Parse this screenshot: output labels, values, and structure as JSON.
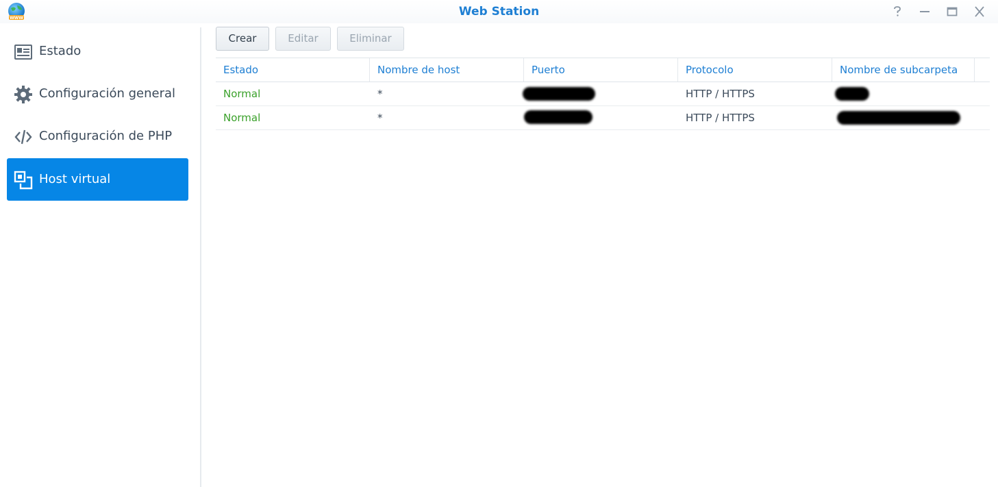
{
  "window": {
    "title": "Web Station",
    "icon": "web-station-globe-icon",
    "controls": [
      "help-icon",
      "minimize-icon",
      "maximize-icon",
      "close-icon"
    ]
  },
  "sidebar": {
    "items": [
      {
        "label": "Estado",
        "icon": "status-card-icon",
        "active": false
      },
      {
        "label": "Configuración general",
        "icon": "gear-icon",
        "active": false
      },
      {
        "label": "Configuración de PHP",
        "icon": "code-icon",
        "active": false
      },
      {
        "label": "Host virtual",
        "icon": "virtual-host-icon",
        "active": true
      }
    ]
  },
  "toolbar": {
    "create_label": "Crear",
    "edit_label": "Editar",
    "delete_label": "Eliminar"
  },
  "table": {
    "headers": [
      "Estado",
      "Nombre de host",
      "Puerto",
      "Protocolo",
      "Nombre de subcarpeta"
    ],
    "rows": [
      {
        "status": "Normal",
        "host": "*",
        "port": "",
        "protocol": "HTTP / HTTPS",
        "subfolder": ""
      },
      {
        "status": "Normal",
        "host": "*",
        "port": "",
        "protocol": "HTTP / HTTPS",
        "subfolder": ""
      }
    ]
  },
  "colors": {
    "accent": "#1e7fd3",
    "active_nav": "#0686e6",
    "status_ok": "#3aa12a"
  }
}
